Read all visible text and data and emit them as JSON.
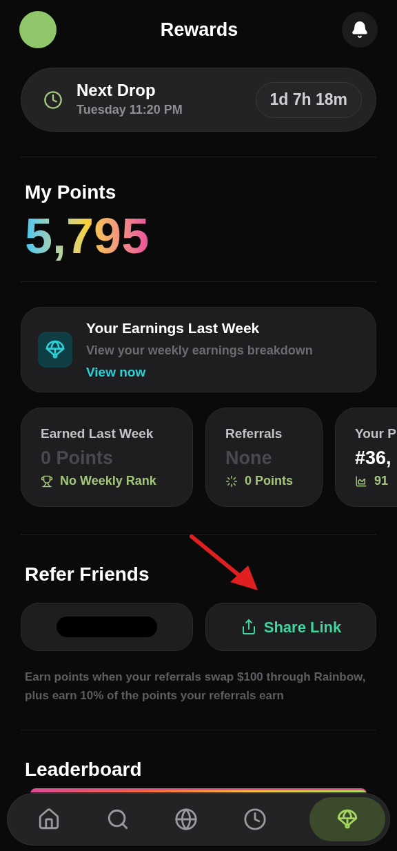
{
  "header": {
    "title": "Rewards"
  },
  "next_drop": {
    "title": "Next Drop",
    "time": "Tuesday 11:20 PM",
    "countdown": "1d 7h 18m"
  },
  "points": {
    "heading": "My Points",
    "value": "5,795"
  },
  "earnings_card": {
    "title": "Your Earnings Last Week",
    "subtitle": "View your weekly earnings breakdown",
    "link": "View now"
  },
  "stats": [
    {
      "kind": "trophy",
      "title": "Earned Last Week",
      "value": "0 Points",
      "value_muted": true,
      "note": "No Weekly Rank"
    },
    {
      "kind": "spinner",
      "title": "Referrals",
      "value": "None",
      "value_muted": true,
      "note": "0 Points"
    },
    {
      "kind": "chart",
      "title": "Your P",
      "value": "#36,",
      "value_muted": false,
      "note": "91"
    }
  ],
  "refer": {
    "heading": "Refer Friends",
    "share_button": "Share Link",
    "description": "Earn points when your referrals swap $100 through Rainbow, plus earn 10% of the points your referrals earn"
  },
  "leaderboard": {
    "heading": "Leaderboard"
  },
  "nav": [
    {
      "kind": "home",
      "selected": false
    },
    {
      "kind": "search",
      "selected": false
    },
    {
      "kind": "globe",
      "selected": false
    },
    {
      "kind": "clock",
      "selected": false
    },
    {
      "kind": "parachute",
      "selected": true
    }
  ]
}
